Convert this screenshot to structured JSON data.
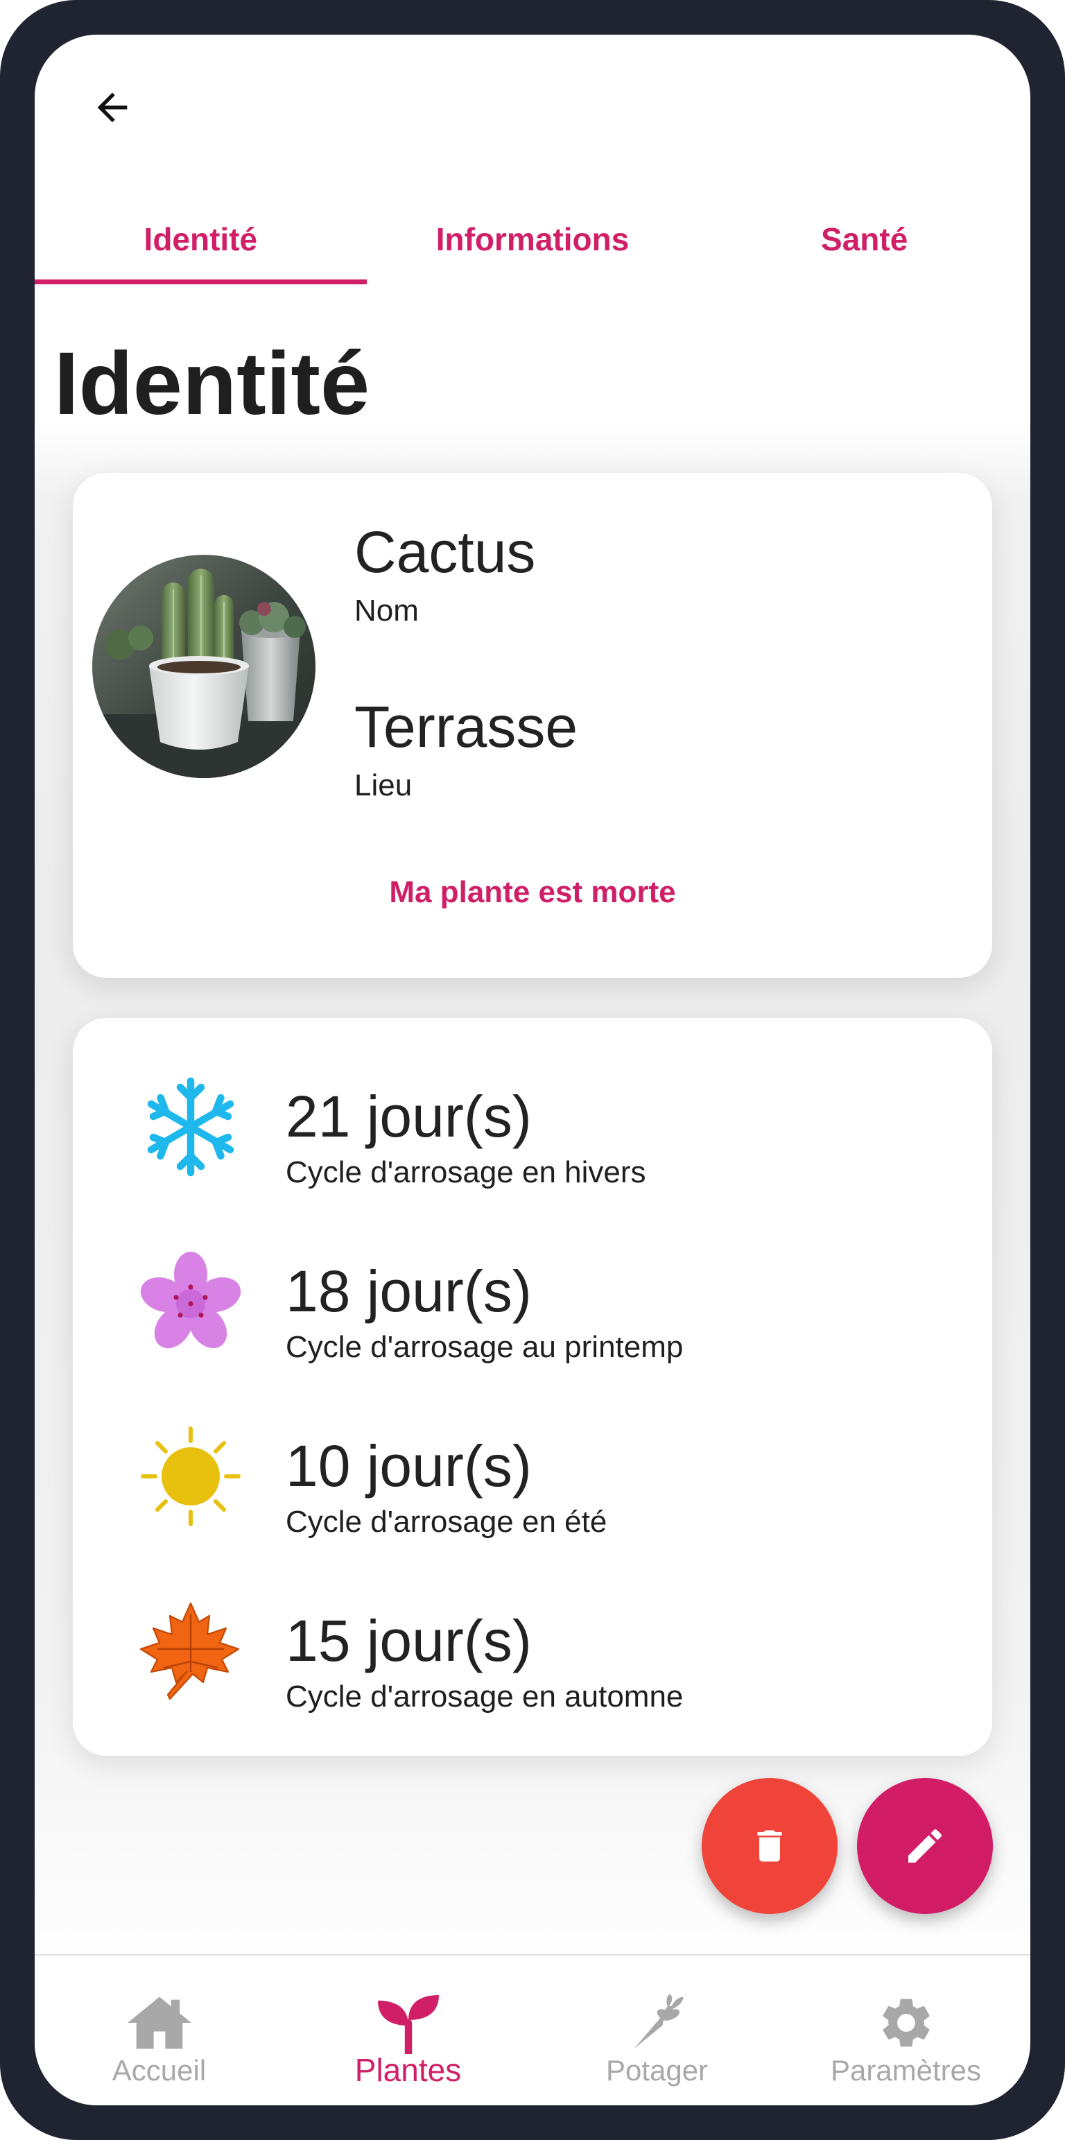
{
  "header": {
    "back_icon": "arrow-left-icon"
  },
  "tabs": [
    {
      "label": "Identité",
      "active": true
    },
    {
      "label": "Informations",
      "active": false
    },
    {
      "label": "Santé",
      "active": false
    }
  ],
  "page": {
    "title": "Identité"
  },
  "identity": {
    "photo": "cactus-photo",
    "name_value": "Cactus",
    "name_label": "Nom",
    "place_value": "Terrasse",
    "place_label": "Lieu",
    "dead_action": "Ma plante est morte"
  },
  "watering_cycles": [
    {
      "icon": "snowflake-icon",
      "value": "21 jour(s)",
      "label": "Cycle d'arrosage en hivers"
    },
    {
      "icon": "flower-icon",
      "value": "18 jour(s)",
      "label": "Cycle d'arrosage au printemp"
    },
    {
      "icon": "sun-icon",
      "value": "10 jour(s)",
      "label": "Cycle d'arrosage en été"
    },
    {
      "icon": "maple-leaf-icon",
      "value": "15 jour(s)",
      "label": "Cycle d'arrosage en automne"
    }
  ],
  "fabs": {
    "delete_icon": "trash-icon",
    "edit_icon": "pencil-icon"
  },
  "bottom_nav": [
    {
      "label": "Accueil",
      "icon": "home-icon",
      "active": false
    },
    {
      "label": "Plantes",
      "icon": "sprout-icon",
      "active": true
    },
    {
      "label": "Potager",
      "icon": "carrot-icon",
      "active": false
    },
    {
      "label": "Paramètres",
      "icon": "gear-icon",
      "active": false
    }
  ],
  "colors": {
    "accent": "#d01f66",
    "delete": "#f0443a",
    "frame": "#1f2430",
    "inactive_nav": "#a8a8a8"
  }
}
